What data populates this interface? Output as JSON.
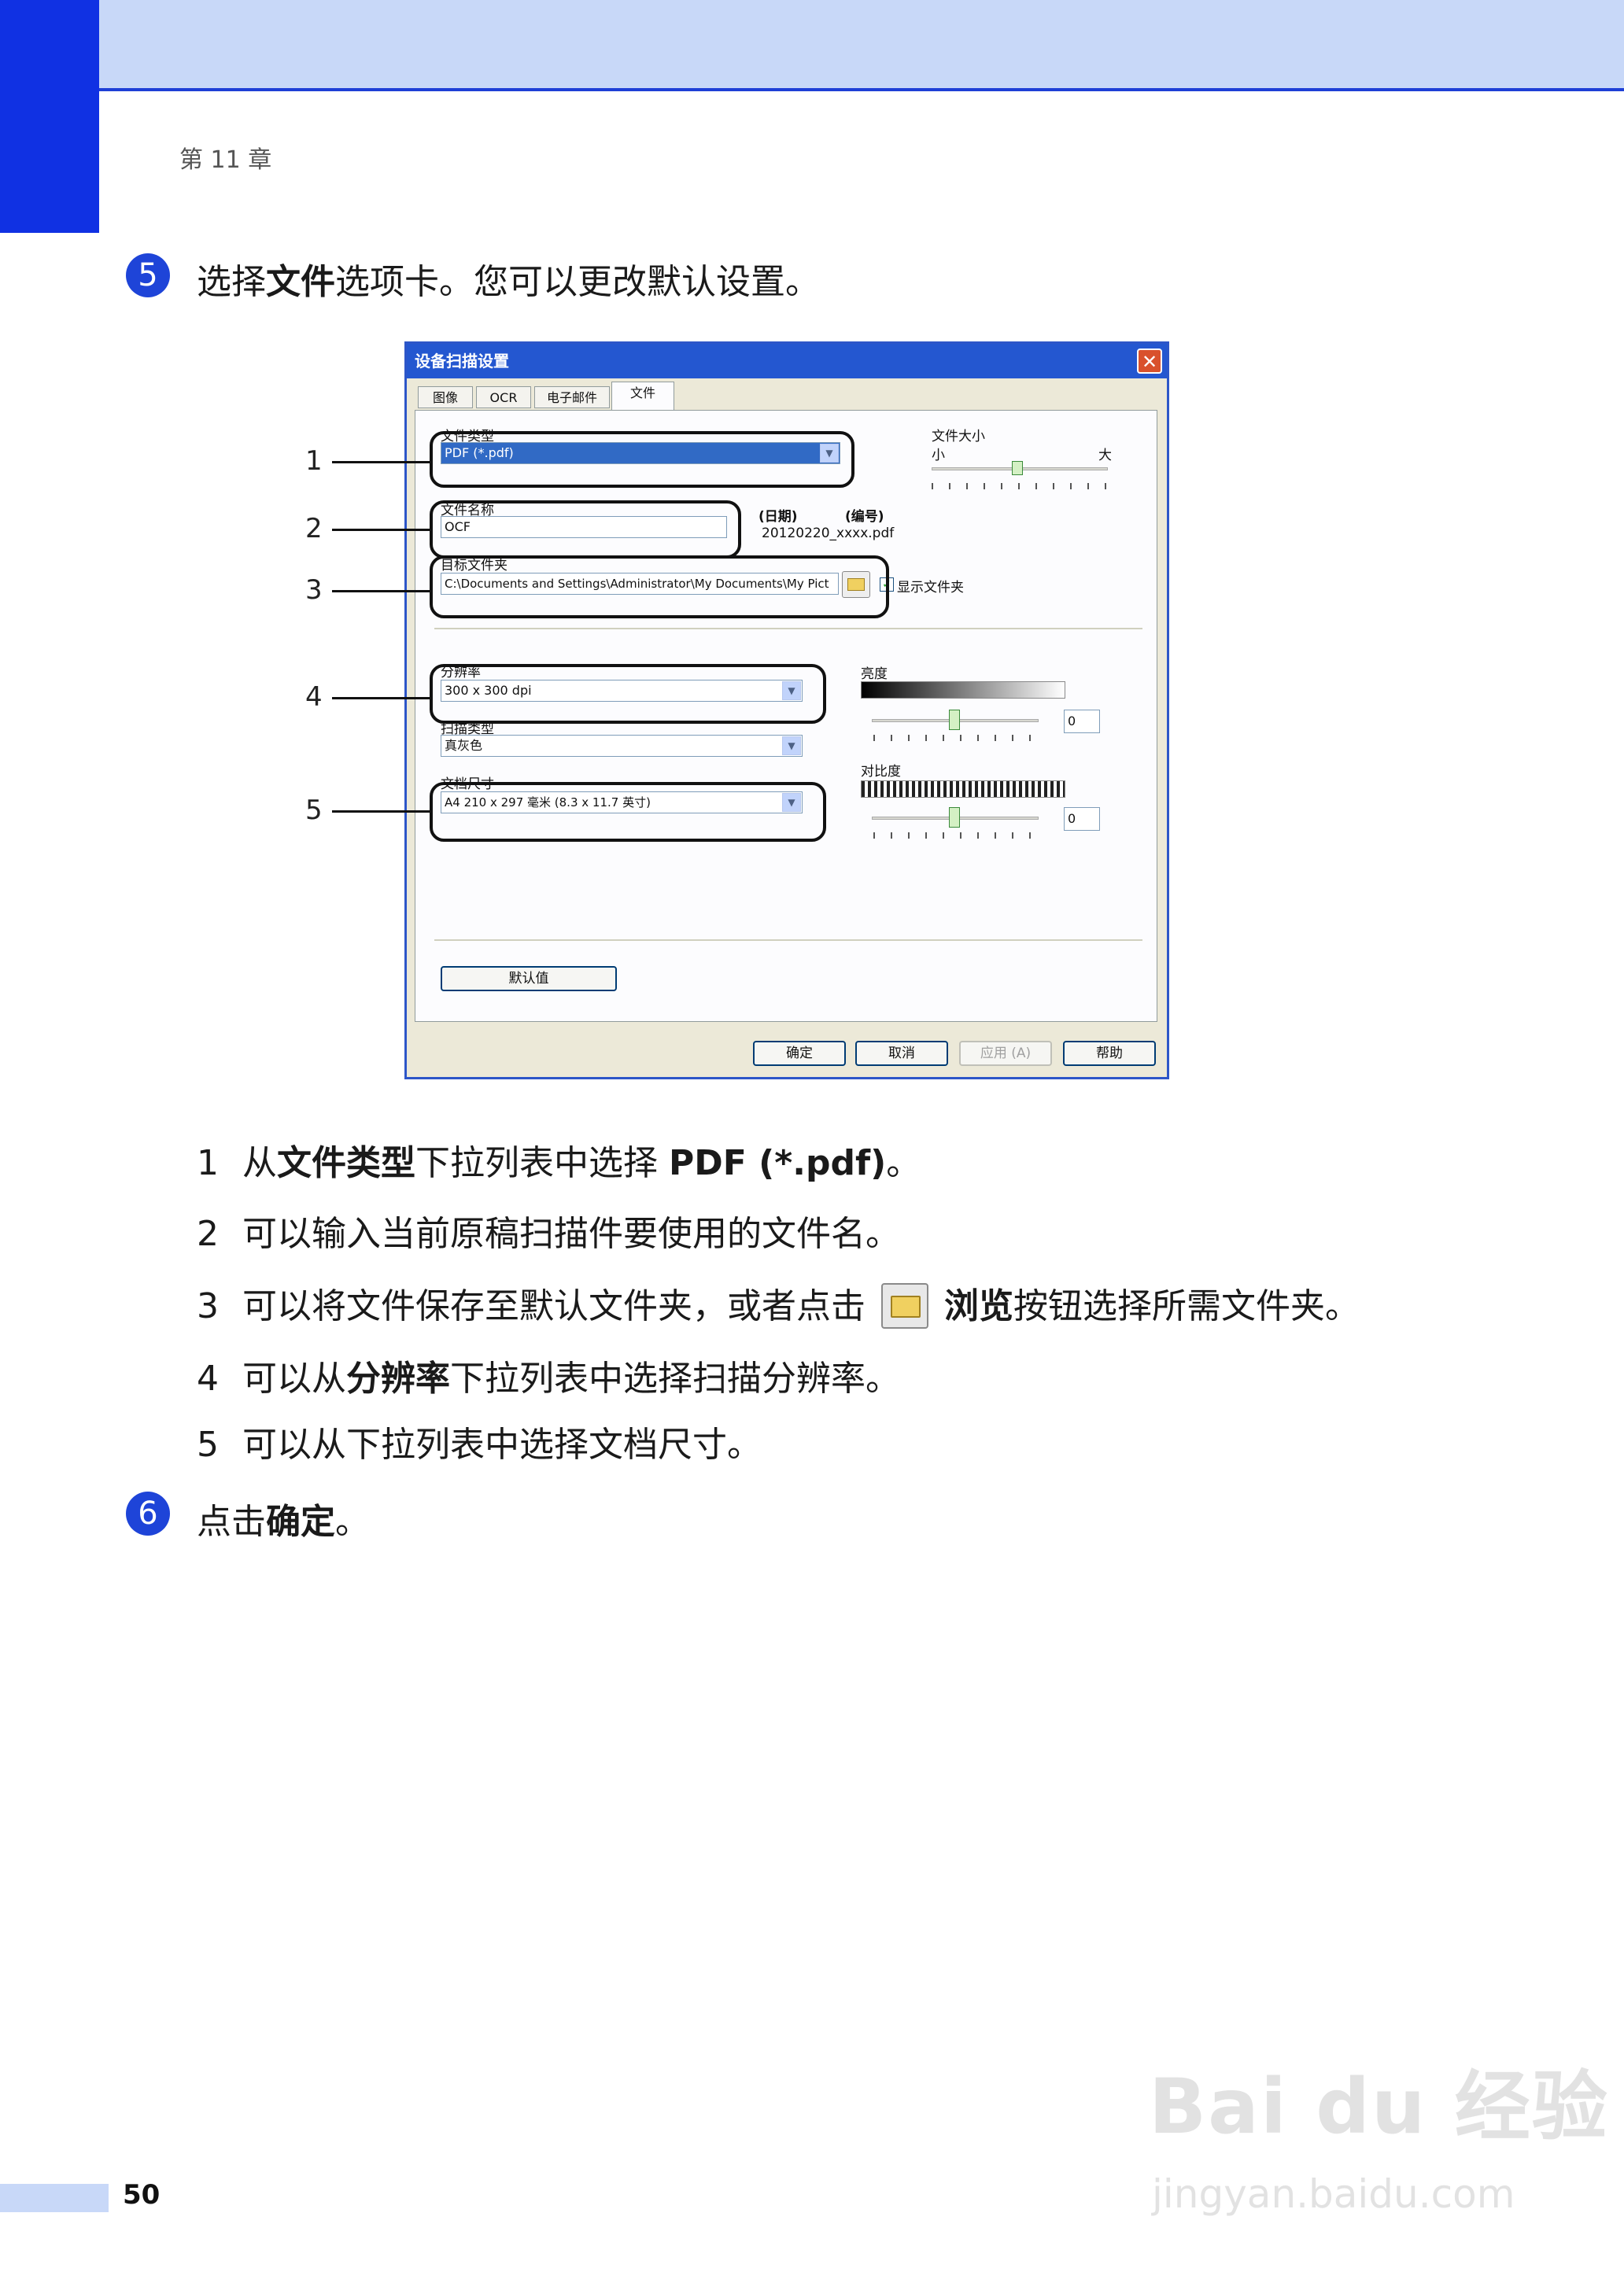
{
  "header": {
    "chapter": "第 11 章"
  },
  "step5": {
    "number": "5",
    "text_before": "选择",
    "text_bold": "文件",
    "text_after": "选项卡。您可以更改默认设置。"
  },
  "dialog": {
    "title": "设备扫描设置",
    "close": "✕",
    "tabs": [
      "图像",
      "OCR",
      "电子邮件",
      "文件"
    ],
    "file_type_label": "文件类型",
    "file_type_value": "PDF (*.pdf)",
    "file_size_label": "文件大小",
    "file_size_small": "小",
    "file_size_large": "大",
    "file_name_label": "文件名称",
    "file_name_value": "OCF",
    "date_label": "(日期)",
    "number_label": "(编号)",
    "file_name_example": "20120220_xxxx.pdf",
    "dest_folder_label": "目标文件夹",
    "dest_folder_value": "C:\\Documents and Settings\\Administrator\\My Documents\\My Pict",
    "show_folder_label": "显示文件夹",
    "resolution_label": "分辨率",
    "resolution_value": "300 x 300 dpi",
    "scan_type_label": "扫描类型",
    "scan_type_value": "真灰色",
    "doc_size_label": "文档尺寸",
    "doc_size_value": "A4 210 x 297 毫米 (8.3 x 11.7 英寸)",
    "brightness_label": "亮度",
    "brightness_value": "0",
    "contrast_label": "对比度",
    "contrast_value": "0",
    "default_button": "默认值",
    "ok_button": "确定",
    "cancel_button": "取消",
    "apply_button": "应用 (A)",
    "help_button": "帮助"
  },
  "callouts": [
    "1",
    "2",
    "3",
    "4",
    "5"
  ],
  "items": [
    {
      "n": "1",
      "a": "从",
      "b": "文件类型",
      "c": "下拉列表中选择 ",
      "d": "PDF (*.pdf)",
      "e": "。"
    },
    {
      "n": "2",
      "a": "可以输入当前原稿扫描件要使用的文件名。"
    },
    {
      "n": "3",
      "a": "可以将文件保存至默认文件夹，或者点击",
      "b": "浏览",
      "c": "按钮选择所需文件夹。"
    },
    {
      "n": "4",
      "a": "可以从",
      "b": "分辨率",
      "c": "下拉列表中选择扫描分辨率。"
    },
    {
      "n": "5",
      "a": "可以从下拉列表中选择文档尺寸。"
    }
  ],
  "step6": {
    "number": "6",
    "text_before": "点击",
    "text_bold": "确定",
    "text_after": "。"
  },
  "footer": {
    "page": "50"
  },
  "watermark": {
    "line1": "Bai du 经验",
    "line2": "jingyan.baidu.com"
  }
}
